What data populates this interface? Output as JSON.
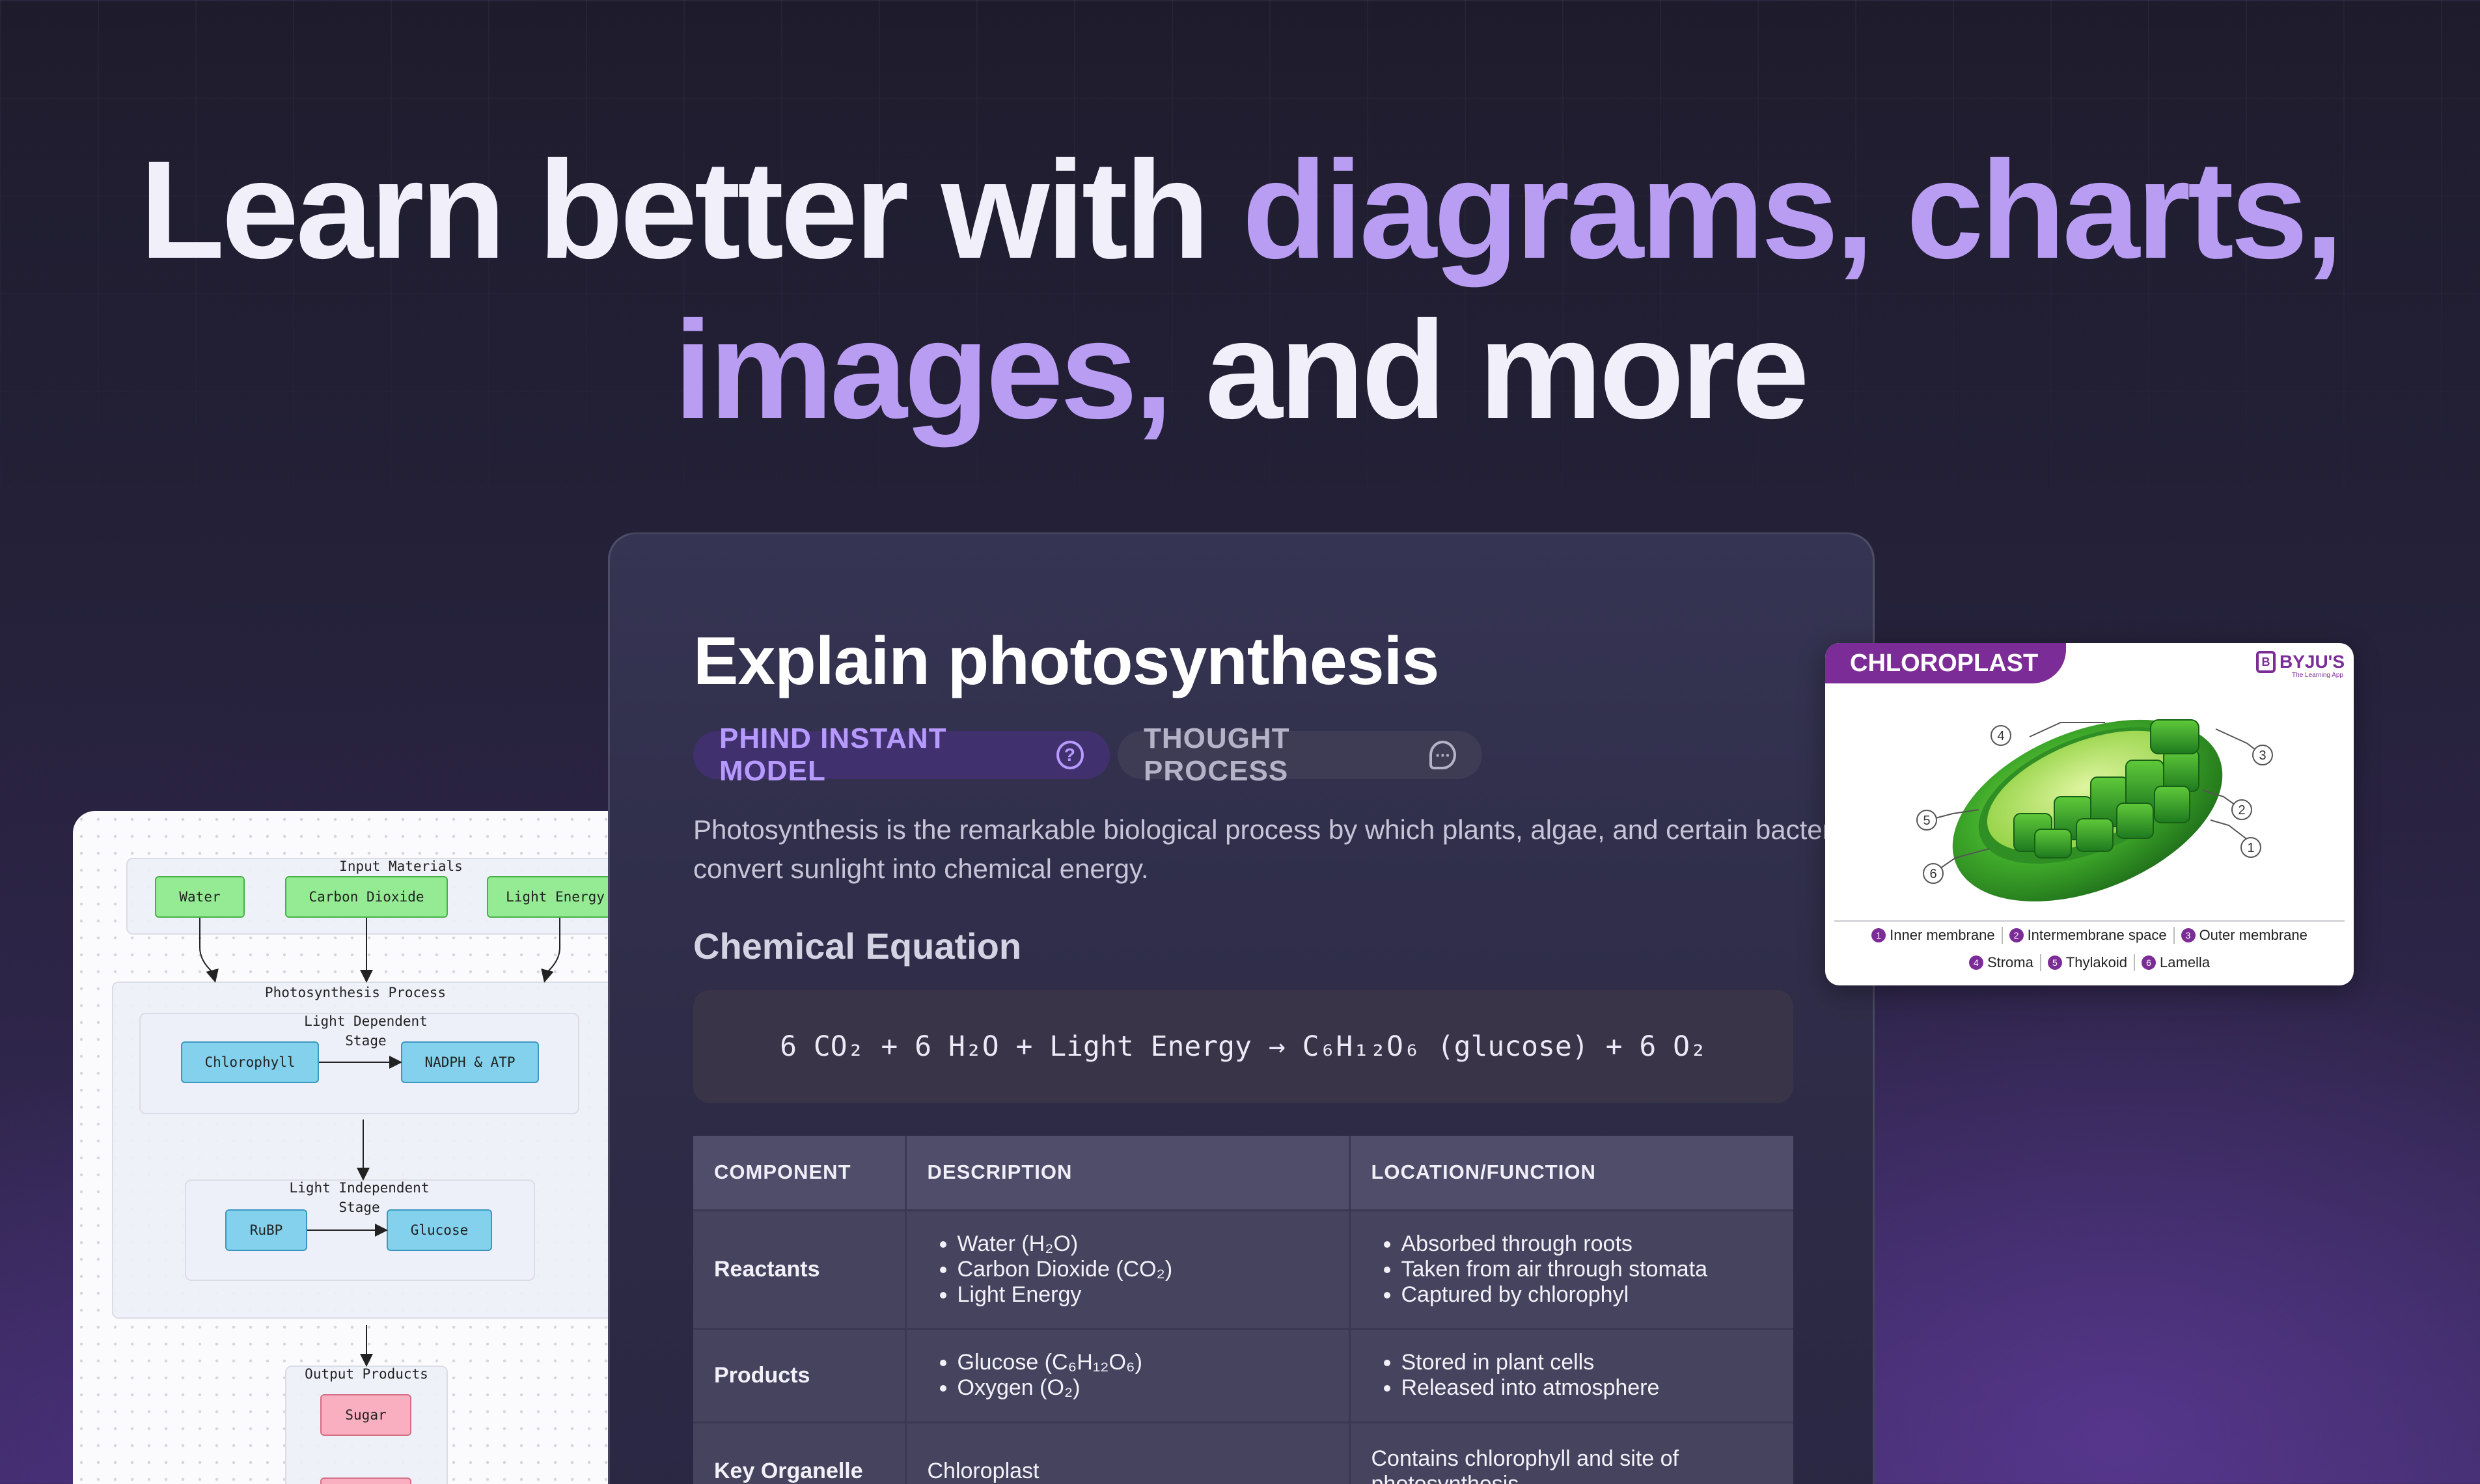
{
  "hero": {
    "line1_a": "Learn better with ",
    "line1_b": "diagrams, charts,",
    "line2_a": "images,",
    "line2_b": " and more"
  },
  "card": {
    "title": "Explain photosynthesis",
    "model_pill": "PHIND INSTANT MODEL",
    "model_pill_icon": "?",
    "thought_pill": "THOUGHT PROCESS",
    "thought_pill_icon": "···",
    "intro": "Photosynthesis is the remarkable biological process by which plants, algae, and certain bacteria convert sunlight into chemical energy.",
    "section": "Chemical Equation",
    "equation": "6 CO₂ + 6 H₂O + Light Energy → C₆H₁₂O₆ (glucose) + 6 O₂",
    "table": {
      "headers": [
        "COMPONENT",
        "DESCRIPTION",
        "LOCATION/FUNCTION"
      ],
      "rows": [
        {
          "component": "Reactants",
          "description": [
            "Water (H₂O)",
            "Carbon Dioxide (CO₂)",
            "Light Energy"
          ],
          "location": [
            "Absorbed through roots",
            "Taken from air through stomata",
            "Captured by chlorophyl"
          ]
        },
        {
          "component": "Products",
          "description": [
            "Glucose (C₆H₁₂O₆)",
            "Oxygen (O₂)"
          ],
          "location": [
            "Stored in plant cells",
            "Released into atmosphere"
          ]
        },
        {
          "component": "Key Organelle",
          "description": "Chloroplast",
          "location": "Contains chlorophyll and site of photosynthesis"
        }
      ]
    }
  },
  "flow": {
    "input_label": "Input Materials",
    "nodes": {
      "water": "Water",
      "co2": "Carbon Dioxide",
      "light": "Light Energy"
    },
    "process_label": "Photosynthesis Process",
    "ld_label": "Light Dependent Stage",
    "ld_nodes": {
      "a": "Chlorophyll",
      "b": "NADPH & ATP"
    },
    "li_label": "Light Independent Stage",
    "li_nodes": {
      "a": "RuBP",
      "b": "Glucose"
    },
    "output_label": "Output Products",
    "output_nodes": {
      "a": "Sugar"
    }
  },
  "chloroplast": {
    "tag": "CHLOROPLAST",
    "brand": "BYJU'S",
    "brand_icon": "B",
    "brand_sub": "The Learning App",
    "callouts": [
      "1",
      "2",
      "3",
      "4",
      "5",
      "6"
    ],
    "legend_row1": [
      {
        "n": "1",
        "label": "Inner membrane"
      },
      {
        "n": "2",
        "label": "Intermembrane space"
      },
      {
        "n": "3",
        "label": "Outer membrane"
      }
    ],
    "legend_row2": [
      {
        "n": "4",
        "label": "Stroma"
      },
      {
        "n": "5",
        "label": "Thylakoid"
      },
      {
        "n": "6",
        "label": "Lamella"
      }
    ]
  },
  "colors": {
    "accent": "#b99df3",
    "model_pill": "#b79aff",
    "brand_purple": "#7b2c96",
    "node_green": "#94eb93",
    "node_blue": "#83d1ec",
    "node_pink": "#f9afbf"
  }
}
